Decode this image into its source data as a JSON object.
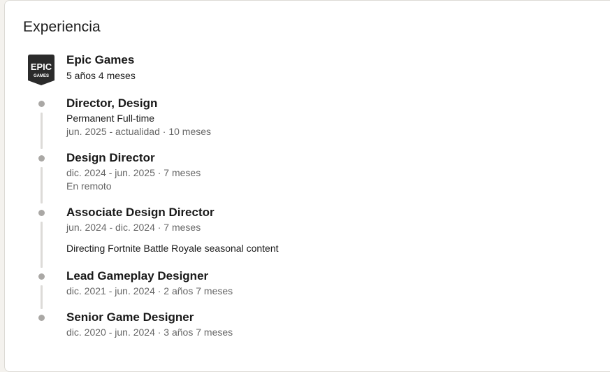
{
  "section_title": "Experiencia",
  "company": {
    "name": "Epic Games",
    "duration": "5 años 4 meses",
    "logo_text_top": "EPIC",
    "logo_text_bottom": "GAMES"
  },
  "positions": [
    {
      "title": "Director, Design",
      "employment_type": "Permanent Full-time",
      "dates": "jun. 2025 - actualidad · 10 meses"
    },
    {
      "title": "Design Director",
      "dates": "dic. 2024 - jun. 2025 · 7 meses",
      "location": "En remoto"
    },
    {
      "title": "Associate Design Director",
      "dates": "jun. 2024 - dic. 2024 · 7 meses",
      "description": "Directing Fortnite Battle Royale seasonal content"
    },
    {
      "title": "Lead Gameplay Designer",
      "dates": "dic. 2021 - jun. 2024 · 2 años 7 meses"
    },
    {
      "title": "Senior Game Designer",
      "dates": "dic. 2020 - jun. 2024 · 3 años 7 meses"
    }
  ]
}
